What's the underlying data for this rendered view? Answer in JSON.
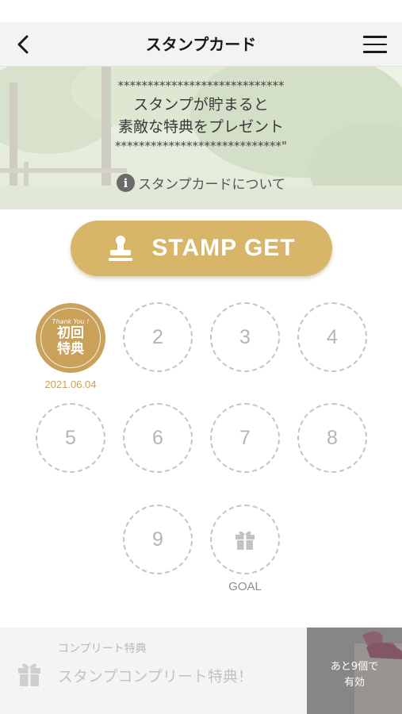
{
  "header": {
    "title": "スタンプカード",
    "back_icon": "chevron-left-icon",
    "menu_icon": "hamburger-menu-icon"
  },
  "banner": {
    "stars_top": "****************************",
    "line1": "スタンプが貯まると",
    "line2": "素敵な特典をプレゼント",
    "stars_bottom": "****************************\"",
    "info_icon": "info-icon",
    "info_link": "スタンプカードについて"
  },
  "stamp_get": {
    "label": "STAMP GET",
    "icon": "stamp-icon",
    "color": "#d7b569"
  },
  "stamps": {
    "first": {
      "thanks": "Thank You !",
      "line1": "初回",
      "line2": "特典",
      "date": "2021.06.04",
      "color": "#c9a15a"
    },
    "slots": [
      "2",
      "3",
      "4",
      "5",
      "6",
      "7",
      "8",
      "9"
    ],
    "goal_icon": "gift-icon",
    "goal_label": "GOAL"
  },
  "complete": {
    "icon": "gift-icon",
    "caption": "コンプリート特典",
    "title": "スタンプコンプリート特典！"
  },
  "remaining": {
    "line1": "あと9個で",
    "line2": "有効"
  }
}
